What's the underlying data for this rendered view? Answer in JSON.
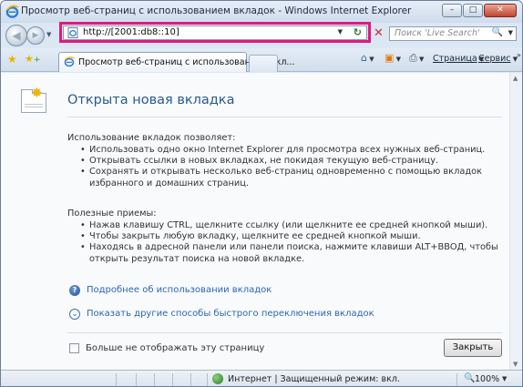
{
  "window": {
    "title": "Просмотр веб-страниц с использованием вкладок - Windows Internet Explorer",
    "minimize": "–",
    "maximize": "□",
    "close": "✕"
  },
  "nav": {
    "back_icon": "back-arrow-icon",
    "forward_icon": "forward-arrow-icon",
    "address_value": "http://[2001:db8::10]",
    "search_placeholder": "Поиск 'Live Search'",
    "highlight_color": "#e0197d"
  },
  "tabs": {
    "active_label": "Просмотр веб-страниц с использованием вкл..."
  },
  "commands": {
    "page": "Страница",
    "tools": "Сервис"
  },
  "page": {
    "heading": "Открыта новая вкладка",
    "section1_title": "Использование вкладок позволяет:",
    "section1_items": [
      "Использовать одно окно Internet Explorer для просмотра всех нужных веб-страниц.",
      "Открывать ссылки в новых вкладках, не покидая текущую веб-страницу.",
      "Сохранять и открывать несколько веб-страниц одновременно с помощью вкладок избранного и домашних страниц."
    ],
    "section2_title": "Полезные приемы:",
    "section2_items": [
      "Нажав клавишу CTRL, щелкните ссылку (или щелкните ее средней кнопкой мыши).",
      "Чтобы закрыть любую вкладку, щелкните ее средней кнопкой мыши.",
      "Находясь в адресной панели или панели поиска, нажмите клавиши ALT+ВВОД, чтобы открыть результат поиска на новой вкладке."
    ],
    "link_help": "Подробнее об использовании вкладок",
    "link_more": "Показать другие способы быстрого переключения вкладок",
    "dont_show_label": "Больше не отображать эту страницу",
    "close_button": "Закрыть"
  },
  "status": {
    "zone_text": "Интернет | Защищенный режим: вкл.",
    "zoom": "100%"
  }
}
